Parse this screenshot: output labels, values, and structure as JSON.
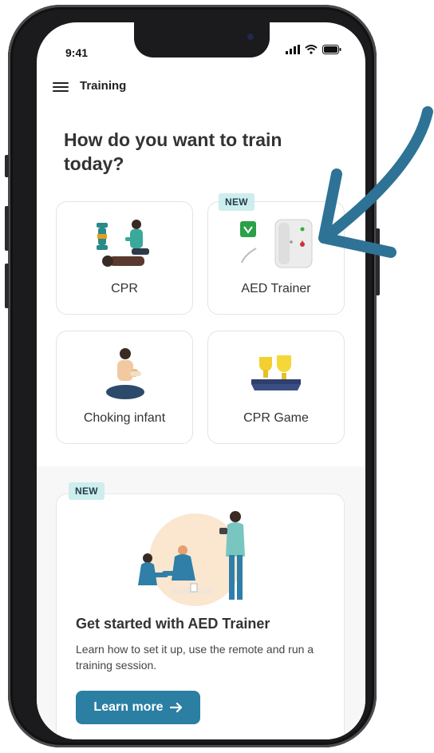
{
  "status_bar": {
    "time": "9:41"
  },
  "topbar": {
    "title": "Training",
    "menu_icon": "hamburger-menu-icon"
  },
  "main": {
    "heading": "How do you want to train today?",
    "cards": [
      {
        "label": "CPR",
        "badge": ""
      },
      {
        "label": "AED Trainer",
        "badge": "NEW"
      },
      {
        "label": "Choking infant",
        "badge": ""
      },
      {
        "label": "CPR Game",
        "badge": ""
      }
    ]
  },
  "promo": {
    "badge": "NEW",
    "title": "Get started with AED Trainer",
    "description": "Learn how to set it up, use the remote and run a training session.",
    "button_label": "Learn more",
    "button_icon": "arrow-right-icon"
  },
  "colors": {
    "accent": "#2a7fa3",
    "badge_bg": "#cdeeed",
    "annotation_arrow": "#2e7396",
    "text_dark": "#333333"
  }
}
